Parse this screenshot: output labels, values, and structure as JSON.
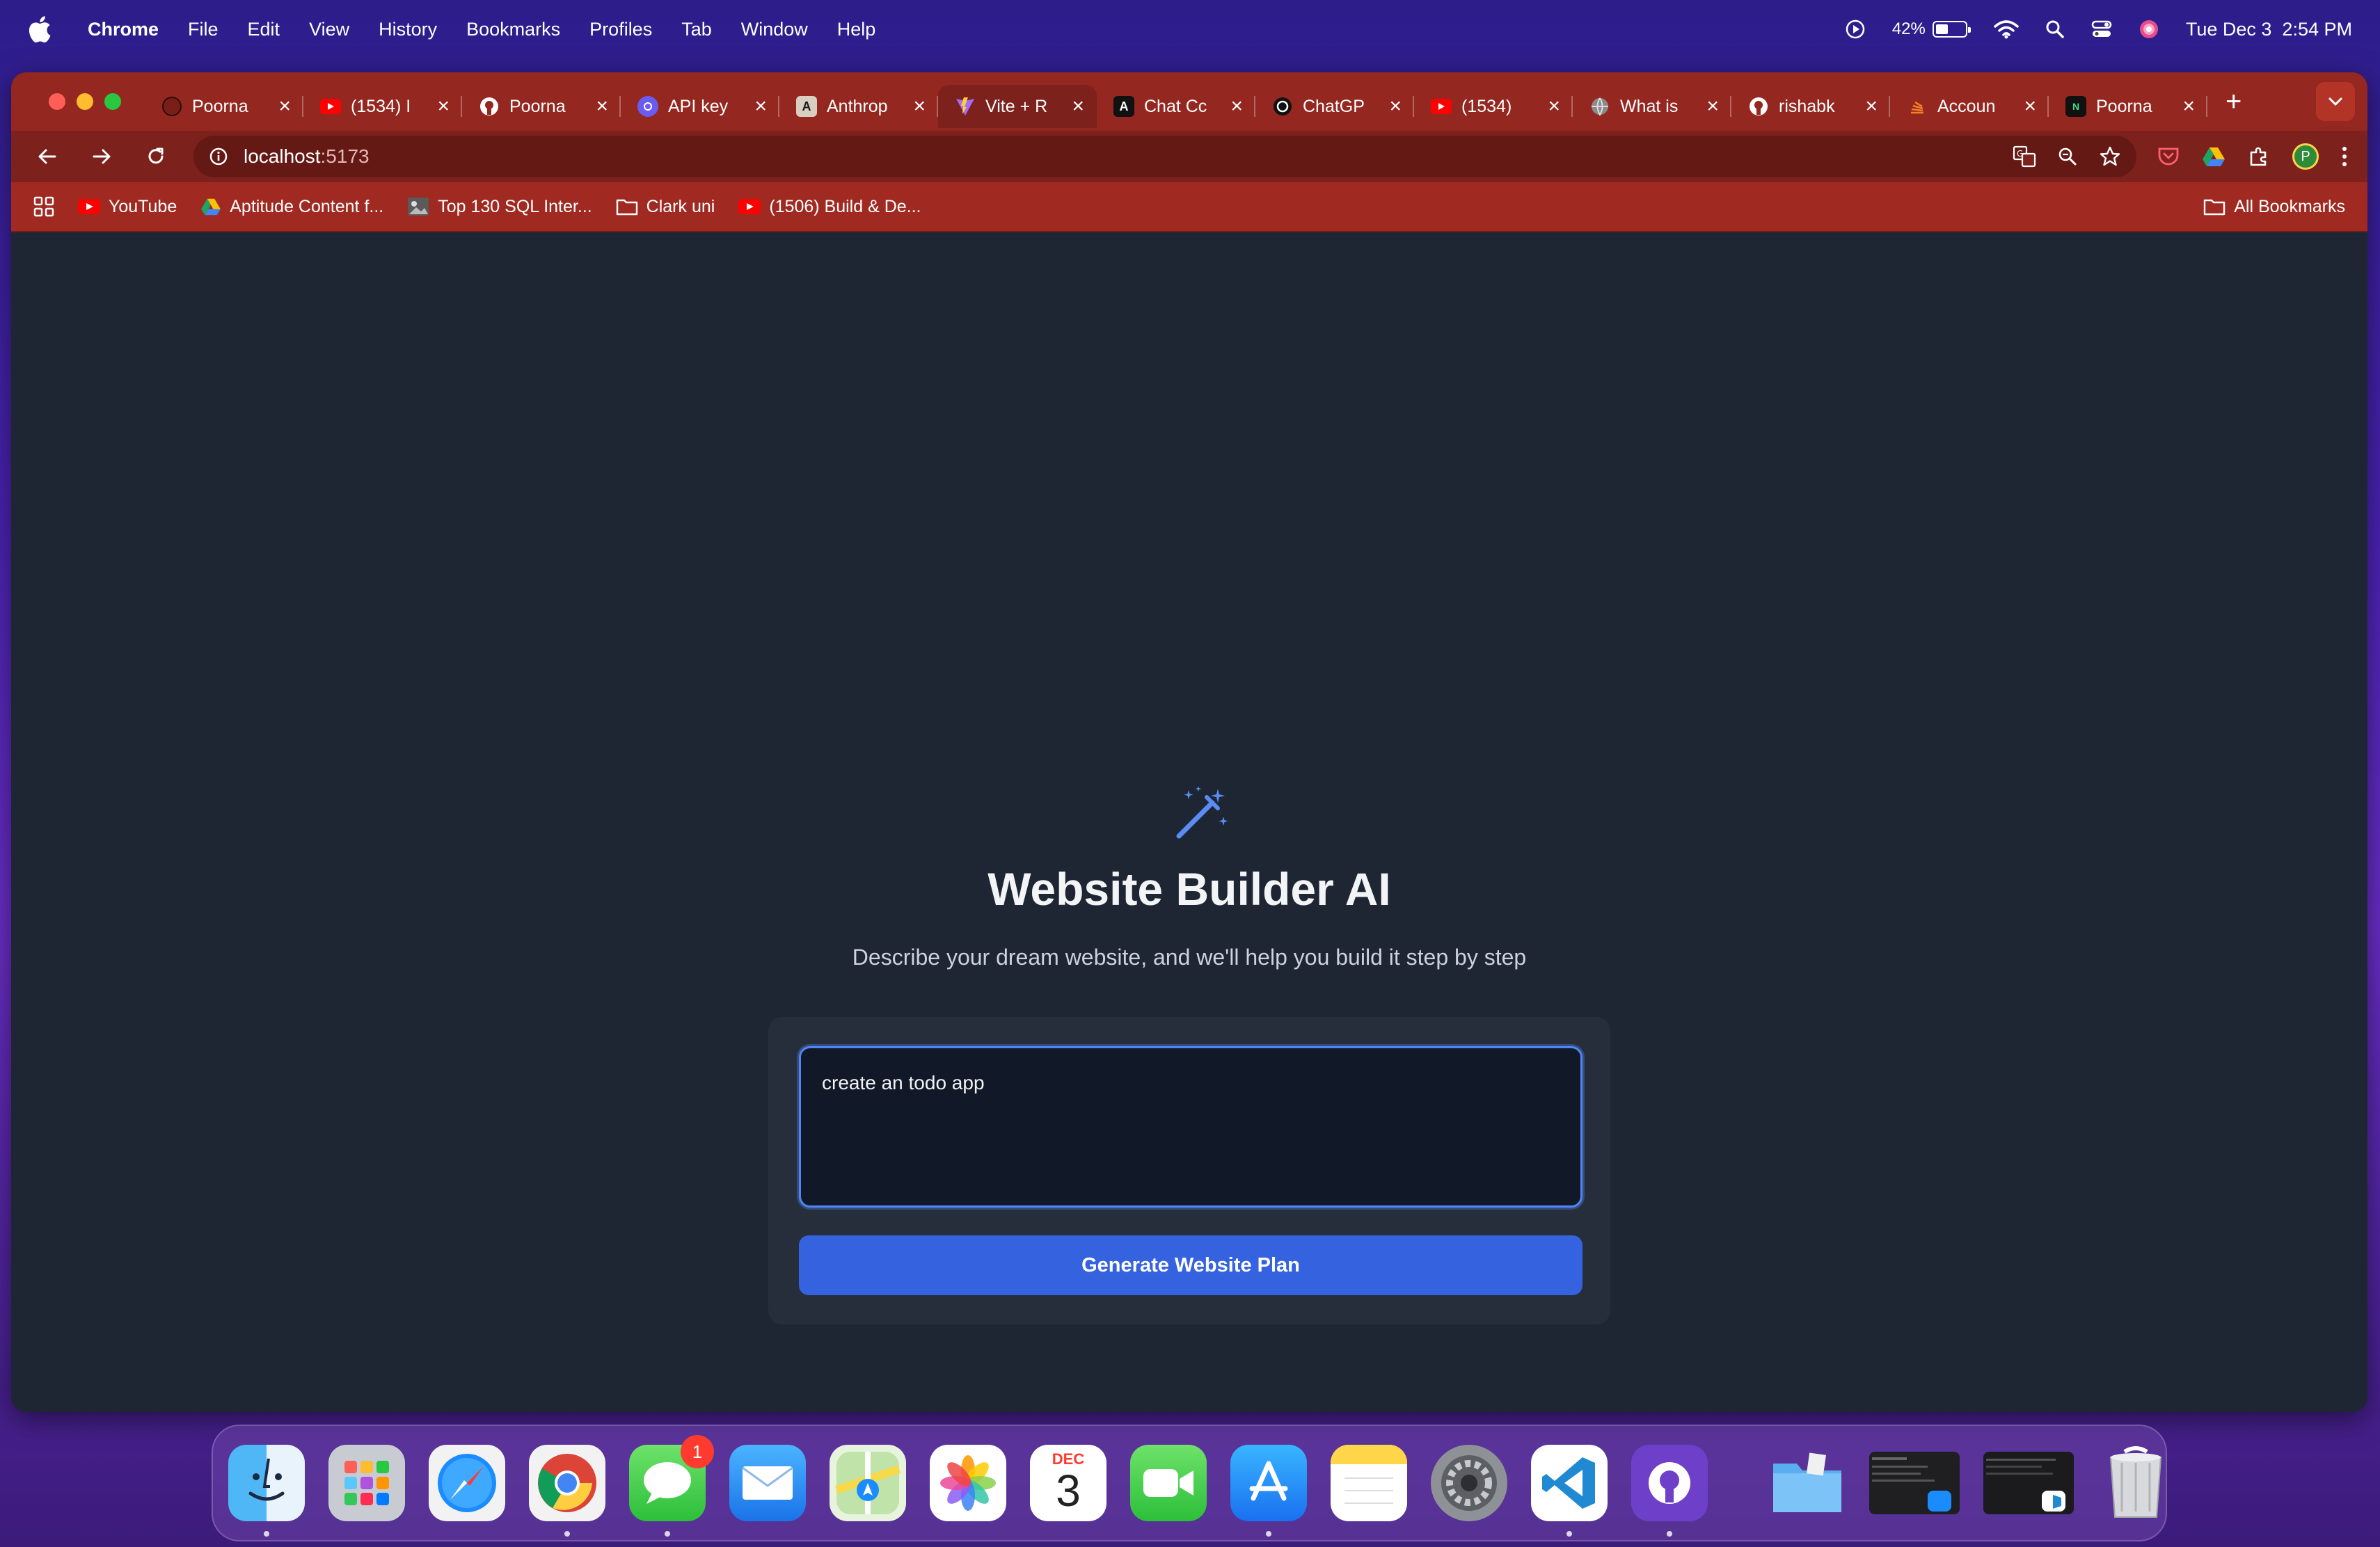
{
  "menubar": {
    "app_name": "Chrome",
    "items": [
      "File",
      "Edit",
      "View",
      "History",
      "Bookmarks",
      "Profiles",
      "Tab",
      "Window",
      "Help"
    ],
    "battery_percent": "42%",
    "battery_level": 0.42,
    "datetime": "Tue Dec 3  2:54 PM"
  },
  "tabs": [
    {
      "title": "Poorna",
      "icon": "github-icon"
    },
    {
      "title": "(1534) I",
      "icon": "youtube-icon"
    },
    {
      "title": "Poorna",
      "icon": "github-icon"
    },
    {
      "title": "API key",
      "icon": "openai-icon"
    },
    {
      "title": "Anthrop",
      "icon": "anthropic-icon"
    },
    {
      "title": "Vite + R",
      "icon": "vite-icon",
      "active": true
    },
    {
      "title": "Chat Cc",
      "icon": "anthropic-icon"
    },
    {
      "title": "ChatGP",
      "icon": "openai-icon"
    },
    {
      "title": "(1534)",
      "icon": "youtube-icon"
    },
    {
      "title": "What is",
      "icon": "globe-icon"
    },
    {
      "title": "rishabk",
      "icon": "github-icon"
    },
    {
      "title": "Accoun",
      "icon": "stack-icon"
    },
    {
      "title": "Poorna",
      "icon": "leetcode-icon"
    }
  ],
  "address_bar": {
    "host": "localhost",
    "port": ":5173"
  },
  "bookmarks": [
    {
      "label": "YouTube",
      "icon": "youtube-icon"
    },
    {
      "label": "Aptitude Content f...",
      "icon": "drive-icon"
    },
    {
      "label": "Top 130 SQL Inter...",
      "icon": "image-icon"
    },
    {
      "label": "Clark uni",
      "icon": "folder-icon"
    },
    {
      "label": "(1506) Build & De...",
      "icon": "youtube-icon"
    }
  ],
  "all_bookmarks_label": "All Bookmarks",
  "profile_initial": "P",
  "app": {
    "title": "Website Builder AI",
    "subtitle": "Describe your dream website, and we'll help you build it step by step",
    "prompt_value": "create an todo app",
    "generate_label": "Generate Website Plan"
  },
  "dock": {
    "messages_badge": "1",
    "calendar_month": "DEC",
    "calendar_day": "3"
  },
  "colors": {
    "tab_strip": "#94271f",
    "page_bg": "#1e2634",
    "accent_blue": "#3563e0",
    "focus_ring": "#4f86f7"
  }
}
